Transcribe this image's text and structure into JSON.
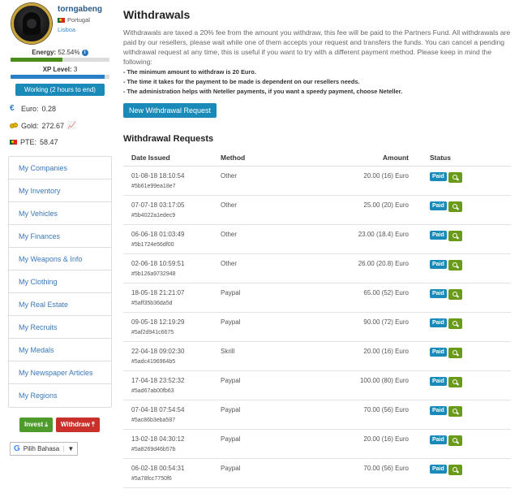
{
  "profile": {
    "username": "torngabeng",
    "country": "Portugal",
    "city": "Lisboa"
  },
  "energy": {
    "label": "Energy:",
    "value": "52.54%",
    "fraction": 0.5254
  },
  "xp": {
    "label": "XP Level:",
    "value": "3",
    "fraction": 0.95
  },
  "working": "Working (2 hours to end)",
  "stats": {
    "euro": {
      "label": "Euro:",
      "value": "0.28",
      "icon": "euro-icon"
    },
    "gold": {
      "label": "Gold:",
      "value": "272.67",
      "icon": "gold-coins-icon"
    },
    "pte": {
      "label": "PTE:",
      "value": "58.47",
      "icon": "portugal-flag-icon"
    }
  },
  "menu": [
    "My Companies",
    "My Inventory",
    "My Vehicles",
    "My Finances",
    "My Weapons & Info",
    "My Clothing",
    "My Real Estate",
    "My Recruits",
    "My Medals",
    "My Newspaper Articles",
    "My Regions"
  ],
  "buttons": {
    "invest": "Invest",
    "withdraw": "Withdraw",
    "new_withdrawal": "New Withdrawal Request"
  },
  "translate": {
    "label": "Pilih Bahasa"
  },
  "page": {
    "title": "Withdrawals",
    "intro": "Withdrawals are taxed a 20% fee from the amount you withdraw, this fee will be paid to the Partners Fund. All withdrawals are paid by our resellers, please wait while one of them accepts your request and transfers the funds. You can cancel a pending withdrawal request at any time, this is useful if you want to try with a different payment method. Please keep in mind the following:",
    "rules": [
      "- The minimum amount to withdraw is 20 Euro.",
      "- The time it takes for the payment to be made is dependent on our resellers needs.",
      "- The administration helps with Neteller payments, if you want a speedy payment, choose Neteller."
    ],
    "requests_title": "Withdrawal Requests"
  },
  "table": {
    "headers": {
      "date": "Date Issued",
      "method": "Method",
      "amount": "Amount",
      "status": "Status"
    },
    "rows": [
      {
        "date": "01-08-18 18:10:54",
        "id": "#5b61e99ea18e7",
        "method": "Other",
        "amount": "20.00 (16) Euro",
        "status": "Paid"
      },
      {
        "date": "07-07-18 03:17:05",
        "id": "#5b4022a1edec9",
        "method": "Other",
        "amount": "25.00 (20) Euro",
        "status": "Paid"
      },
      {
        "date": "06-06-18 01:03:49",
        "id": "#5b1724e56df00",
        "method": "Other",
        "amount": "23.00 (18.4) Euro",
        "status": "Paid"
      },
      {
        "date": "02-06-18 10:59:51",
        "id": "#5b126a9732948",
        "method": "Other",
        "amount": "26.00 (20.8) Euro",
        "status": "Paid"
      },
      {
        "date": "18-05-18 21:21:07",
        "id": "#5aff35b36da5d",
        "method": "Paypal",
        "amount": "65.00 (52) Euro",
        "status": "Paid"
      },
      {
        "date": "09-05-18 12:19:29",
        "id": "#5af2d941c6675",
        "method": "Paypal",
        "amount": "90.00 (72) Euro",
        "status": "Paid"
      },
      {
        "date": "22-04-18 09:02:30",
        "id": "#5adc4196964b5",
        "method": "Skrill",
        "amount": "20.00 (16) Euro",
        "status": "Paid"
      },
      {
        "date": "17-04-18 23:52:32",
        "id": "#5ad67ab00fb63",
        "method": "Paypal",
        "amount": "100.00 (80) Euro",
        "status": "Paid"
      },
      {
        "date": "07-04-18 07:54:54",
        "id": "#5ac86b3eba587",
        "method": "Paypal",
        "amount": "70.00 (56) Euro",
        "status": "Paid"
      },
      {
        "date": "13-02-18 04:30:12",
        "id": "#5a8269d46b57b",
        "method": "Paypal",
        "amount": "20.00 (16) Euro",
        "status": "Paid"
      },
      {
        "date": "06-02-18 00:54:31",
        "id": "#5a78fcc7750f6",
        "method": "Paypal",
        "amount": "70.00 (56) Euro",
        "status": "Paid"
      }
    ]
  }
}
